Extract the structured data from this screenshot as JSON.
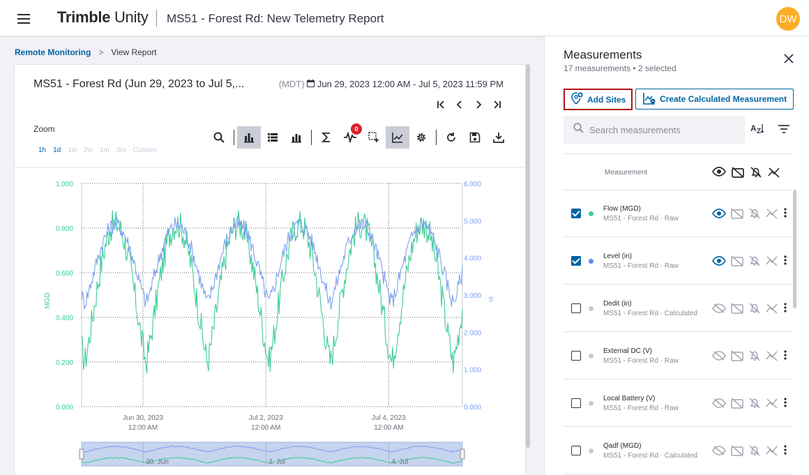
{
  "header": {
    "brand_bold": "Trimble",
    "brand_light": "Unity",
    "title": "MS51 - Forest Rd: New Telemetry Report",
    "avatar_initials": "DW",
    "avatar_color": "#fbad26"
  },
  "breadcrumb": {
    "parent": "Remote Monitoring",
    "separator": ">",
    "current": "View Report"
  },
  "report": {
    "title": "MS51 - Forest Rd (Jun 29, 2023 to Jul 5,...",
    "timezone": "(MDT)",
    "range": "Jun 29, 2023 12:00 AM - Jul 5, 2023 11:59 PM",
    "nav": {
      "first": "|<",
      "prev": "<",
      "next": ">",
      "last": ">|"
    },
    "zoom_label": "Zoom",
    "zoom_options": [
      "1h",
      "1d",
      "1w",
      "2w",
      "1m",
      "3m",
      "Custom"
    ],
    "zoom_enabled": [
      true,
      true,
      false,
      false,
      false,
      false,
      false
    ],
    "toolbar": {
      "icons": [
        "search-icon",
        "bar-chart-icon",
        "list-icon",
        "stacked-bar-icon",
        "sigma-icon",
        "pulse-icon",
        "select-region-icon",
        "line-chart-icon",
        "gear-icon",
        "refresh-icon",
        "save-icon",
        "download-icon"
      ],
      "alert_count": "0"
    }
  },
  "chart_data": {
    "type": "line",
    "x_ticks": [
      {
        "line1": "Jun 30, 2023",
        "line2": "12:00 AM"
      },
      {
        "line1": "Jul 2, 2023",
        "line2": "12:00 AM"
      },
      {
        "line1": "Jul 4, 2023",
        "line2": "12:00 AM"
      }
    ],
    "ylabel_left": "MGD",
    "ylabel_right": "in",
    "y_left_ticks": [
      "0.000",
      "0.200",
      "0.400",
      "0.600",
      "0.800",
      "1.000"
    ],
    "y_right_ticks": [
      "0.000",
      "1.000",
      "2.000",
      "3.000",
      "4.000",
      "5.000",
      "6.000"
    ],
    "ylim_left": [
      0,
      1
    ],
    "ylim_right": [
      0,
      6
    ],
    "x_days": [
      0,
      6.2
    ],
    "series": [
      {
        "name": "Flow (MGD)",
        "color": "#3bcc96",
        "axis": "left",
        "daily_min": 0.2,
        "daily_max": 0.82
      },
      {
        "name": "Level (in)",
        "color": "#7da0ef",
        "axis": "right",
        "daily_min": 2.8,
        "daily_max": 4.9
      }
    ],
    "navigator_labels": [
      "30. Jun",
      "2. Jul",
      "4. Jul"
    ],
    "grid": true
  },
  "panel": {
    "title": "Measurements",
    "subtitle": "17 measurements • 2 selected",
    "add_sites": "Add Sites",
    "create_calc": "Create Calculated Measurement",
    "search_placeholder": "Search measurements",
    "sort_label": "AZ",
    "column_header": "Measurement",
    "rows": [
      {
        "name": "Flow (MGD)",
        "sub": "MS51 - Forest Rd · Raw",
        "checked": true,
        "dot": "#3bcc96"
      },
      {
        "name": "Level (in)",
        "sub": "MS51 - Forest Rd · Raw",
        "checked": true,
        "dot": "#5b8ded"
      },
      {
        "name": "Dedit (in)",
        "sub": "MS51 - Forest Rd · Calculated",
        "checked": false,
        "dot": "#c9c9cf"
      },
      {
        "name": "External DC (V)",
        "sub": "MS51 - Forest Rd · Raw",
        "checked": false,
        "dot": "#c9c9cf"
      },
      {
        "name": "Local Battery (V)",
        "sub": "MS51 - Forest Rd · Raw",
        "checked": false,
        "dot": "#c9c9cf"
      },
      {
        "name": "Qadf (MGD)",
        "sub": "MS51 - Forest Rd · Calculated",
        "checked": false,
        "dot": "#c9c9cf"
      }
    ]
  }
}
